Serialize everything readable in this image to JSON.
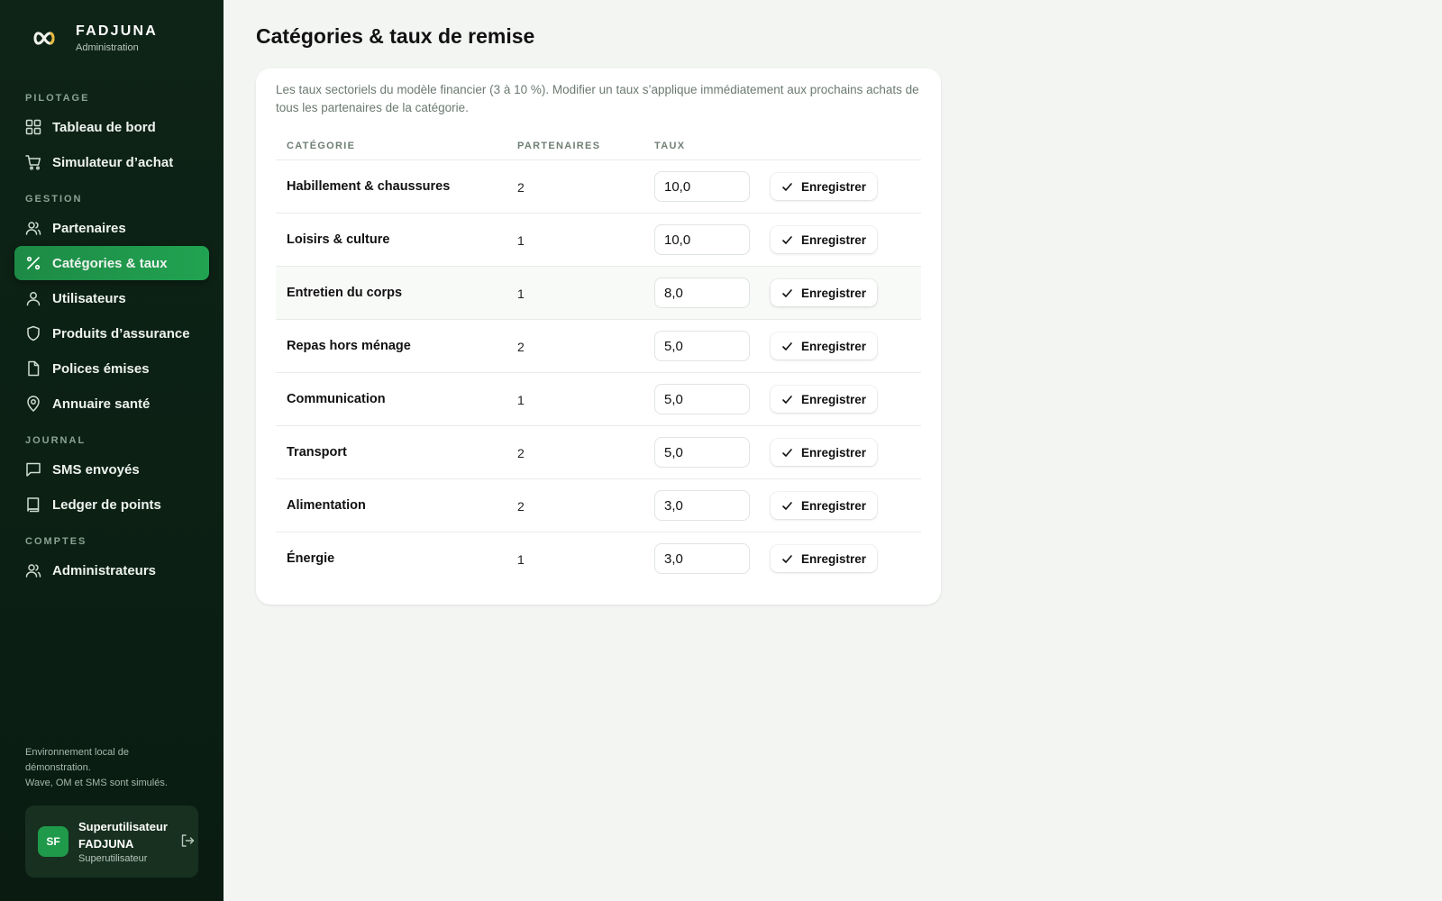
{
  "brand": {
    "name": "FADJUNA",
    "subtitle": "Administration",
    "logo": "infinity-icon"
  },
  "sidebar": {
    "sections": [
      {
        "label": "PILOTAGE",
        "items": [
          {
            "label": "Tableau de bord",
            "icon": "grid-icon"
          },
          {
            "label": "Simulateur d’achat",
            "icon": "cart-icon"
          }
        ]
      },
      {
        "label": "GESTION",
        "items": [
          {
            "label": "Partenaires",
            "icon": "users-icon"
          },
          {
            "label": "Catégories & taux",
            "icon": "percent-icon",
            "active": true
          },
          {
            "label": "Utilisateurs",
            "icon": "user-icon"
          },
          {
            "label": "Produits d’assurance",
            "icon": "shield-icon"
          },
          {
            "label": "Polices émises",
            "icon": "file-icon"
          },
          {
            "label": "Annuaire santé",
            "icon": "map-pin-icon"
          }
        ]
      },
      {
        "label": "JOURNAL",
        "items": [
          {
            "label": "SMS envoyés",
            "icon": "message-icon"
          },
          {
            "label": "Ledger de points",
            "icon": "book-icon"
          }
        ]
      },
      {
        "label": "COMPTES",
        "items": [
          {
            "label": "Administrateurs",
            "icon": "users-icon"
          }
        ]
      }
    ],
    "env_note_line1": "Environnement local de démonstration.",
    "env_note_line2": "Wave, OM et SMS sont simulés.",
    "user": {
      "initials": "SF",
      "name": "Superutilisateur FADJUNA",
      "role": "Superutilisateur"
    }
  },
  "page": {
    "title": "Catégories & taux de remise",
    "description": "Les taux sectoriels du modèle financier (3 à 10 %). Modifier un taux s’applique immédiatement aux prochains achats de tous les partenaires de la catégorie.",
    "columns": {
      "category": "CATÉGORIE",
      "partners": "PARTENAIRES",
      "rate": "TAUX"
    },
    "save_label": "Enregistrer",
    "rows": [
      {
        "category": "Habillement & chaussures",
        "partners": "2",
        "rate": "10,0"
      },
      {
        "category": "Loisirs & culture",
        "partners": "1",
        "rate": "10,0"
      },
      {
        "category": "Entretien du corps",
        "partners": "1",
        "rate": "8,0"
      },
      {
        "category": "Repas hors ménage",
        "partners": "2",
        "rate": "5,0"
      },
      {
        "category": "Communication",
        "partners": "1",
        "rate": "5,0"
      },
      {
        "category": "Transport",
        "partners": "2",
        "rate": "5,0"
      },
      {
        "category": "Alimentation",
        "partners": "2",
        "rate": "3,0"
      },
      {
        "category": "Énergie",
        "partners": "1",
        "rate": "3,0"
      }
    ]
  },
  "colors": {
    "accent": "#21a351",
    "sidebar_bg": "#0e2417",
    "page_bg": "#f3f5f3"
  }
}
